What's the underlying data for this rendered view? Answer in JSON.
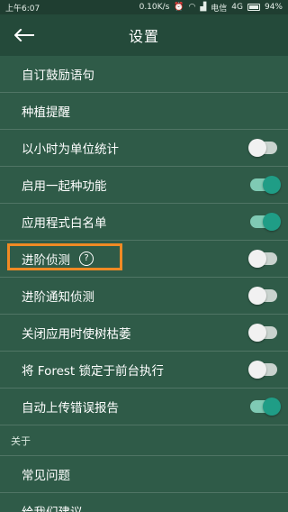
{
  "status": {
    "time": "上午6:07",
    "speed": "0.10K/s",
    "carrier": "电信",
    "network": "4G",
    "battery": "94%"
  },
  "header": {
    "title": "设置"
  },
  "settings": {
    "items": [
      {
        "label": "自订鼓励语句"
      },
      {
        "label": "种植提醒"
      },
      {
        "label": "以小时为单位统计",
        "toggle": false
      },
      {
        "label": "启用一起种功能",
        "toggle": true
      },
      {
        "label": "应用程式白名单",
        "toggle": true
      },
      {
        "label": "进阶侦测",
        "toggle": false,
        "help": "?"
      },
      {
        "label": "进阶通知侦测",
        "toggle": false
      },
      {
        "label": "关闭应用时使树枯萎",
        "toggle": false
      },
      {
        "label": "将 Forest 锁定于前台执行",
        "toggle": false
      },
      {
        "label": "自动上传错误报告",
        "toggle": true
      }
    ],
    "about_section": "关于",
    "about_items": [
      {
        "label": "常见问题"
      },
      {
        "label": "给我们建议"
      }
    ]
  },
  "colors": {
    "background": "#2f5b48",
    "toolbar": "#244a3a",
    "toggle_on": "#1f9d86",
    "highlight": "#f08a24"
  }
}
